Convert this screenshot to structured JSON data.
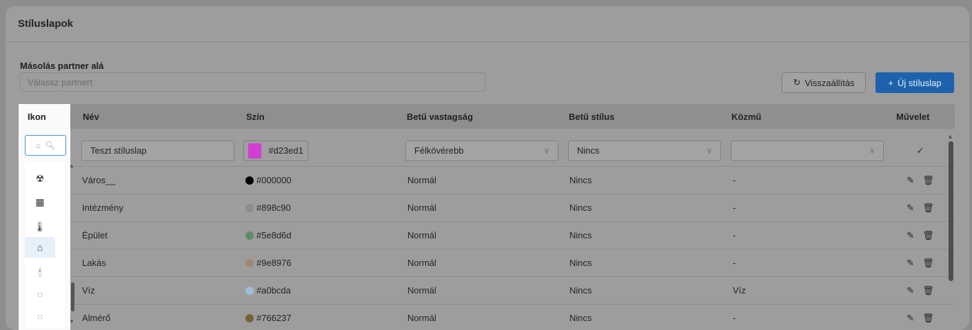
{
  "card": {
    "title": "Stíluslapok",
    "copy_label": "Másolás partner alá",
    "partner_placeholder": "Válassz partnert",
    "reset_label": "Visszaállítás",
    "new_label": "Új stíluslap"
  },
  "table": {
    "headers": {
      "icon": "Ikon",
      "name": "Név",
      "color": "Szín",
      "weight": "Betű vastagság",
      "style": "Betű stílus",
      "utility": "Közmű",
      "action": "Művelet"
    },
    "edit_row": {
      "name": "Teszt stíluslap",
      "color": "#d23ed1",
      "weight": "Félkövérebb",
      "style": "Nincs",
      "utility": ""
    },
    "rows": [
      {
        "name": "Város__",
        "color": "#000000",
        "weight": "Normál",
        "style": "Nincs",
        "utility": "-"
      },
      {
        "name": "Intézmény",
        "color": "#898c90",
        "weight": "Normál",
        "style": "Nincs",
        "utility": "-"
      },
      {
        "name": "Épület",
        "color": "#5e8d6d",
        "weight": "Normál",
        "style": "Nincs",
        "utility": "-"
      },
      {
        "name": "Lakás",
        "color": "#9e8976",
        "weight": "Normál",
        "style": "Nincs",
        "utility": "-"
      },
      {
        "name": "Víz",
        "color": "#a0bcda",
        "weight": "Normál",
        "style": "Nincs",
        "utility": "Víz"
      },
      {
        "name": "Almérő",
        "color": "#766237",
        "weight": "Normál",
        "style": "Nincs",
        "utility": "-"
      }
    ]
  },
  "icon_picker": {
    "items": [
      "radiation-icon",
      "building-grid-icon",
      "thermometer-icon",
      "house-water-icon",
      "candle-icon",
      "dashed-circle-icon",
      "dashed-circle-icon"
    ],
    "selected": "house-water-icon"
  }
}
